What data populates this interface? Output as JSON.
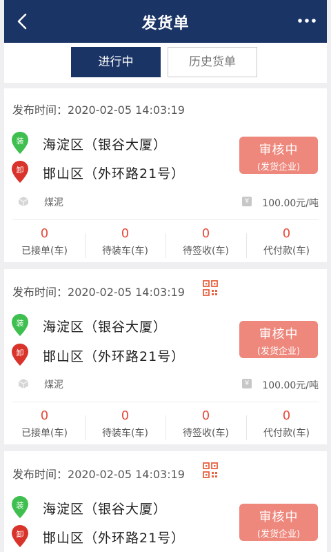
{
  "header": {
    "title": "发货单",
    "back_icon": "chevron-left-icon",
    "more_icon": "more-dots-icon"
  },
  "tabs": [
    {
      "label": "进行中",
      "active": true
    },
    {
      "label": "历史货单",
      "active": false
    }
  ],
  "colors": {
    "primary": "#1b3466",
    "status_bg": "#ee877c",
    "number": "#e64a3b",
    "load_pin": "#3fbf4f",
    "unload_pin": "#d9342b"
  },
  "orders": [
    {
      "time_label": "发布时间：",
      "time": "2020-02-05 14:03:19",
      "qr_icon": false,
      "load_tag": "装",
      "load_address": "海淀区（银谷大厦）",
      "unload_tag": "卸",
      "unload_address": "邯山区（外环路21号）",
      "status": "审核中",
      "status_sub": "(发货企业)",
      "goods": "煤泥",
      "yen_symbol": "¥",
      "price": "100.00元/吨",
      "stats": [
        {
          "value": "0",
          "label": "已接单(车)"
        },
        {
          "value": "0",
          "label": "待装车(车)"
        },
        {
          "value": "0",
          "label": "待签收(车)"
        },
        {
          "value": "0",
          "label": "代付款(车)"
        }
      ]
    },
    {
      "time_label": "发布时间：",
      "time": "2020-02-05 14:03:19",
      "qr_icon": true,
      "load_tag": "装",
      "load_address": "海淀区（银谷大厦）",
      "unload_tag": "卸",
      "unload_address": "邯山区（外环路21号）",
      "status": "审核中",
      "status_sub": "(发货企业)",
      "goods": "煤泥",
      "yen_symbol": "¥",
      "price": "100.00元/吨",
      "stats": [
        {
          "value": "0",
          "label": "已接单(车)"
        },
        {
          "value": "0",
          "label": "待装车(车)"
        },
        {
          "value": "0",
          "label": "待签收(车)"
        },
        {
          "value": "0",
          "label": "代付款(车)"
        }
      ]
    },
    {
      "time_label": "发布时间：",
      "time": "2020-02-05 14:03:19",
      "qr_icon": true,
      "load_tag": "装",
      "load_address": "海淀区（银谷大厦）",
      "unload_tag": "卸",
      "unload_address": "邯山区（外环路21号）",
      "status": "审核中",
      "status_sub": "(发货企业)"
    }
  ]
}
